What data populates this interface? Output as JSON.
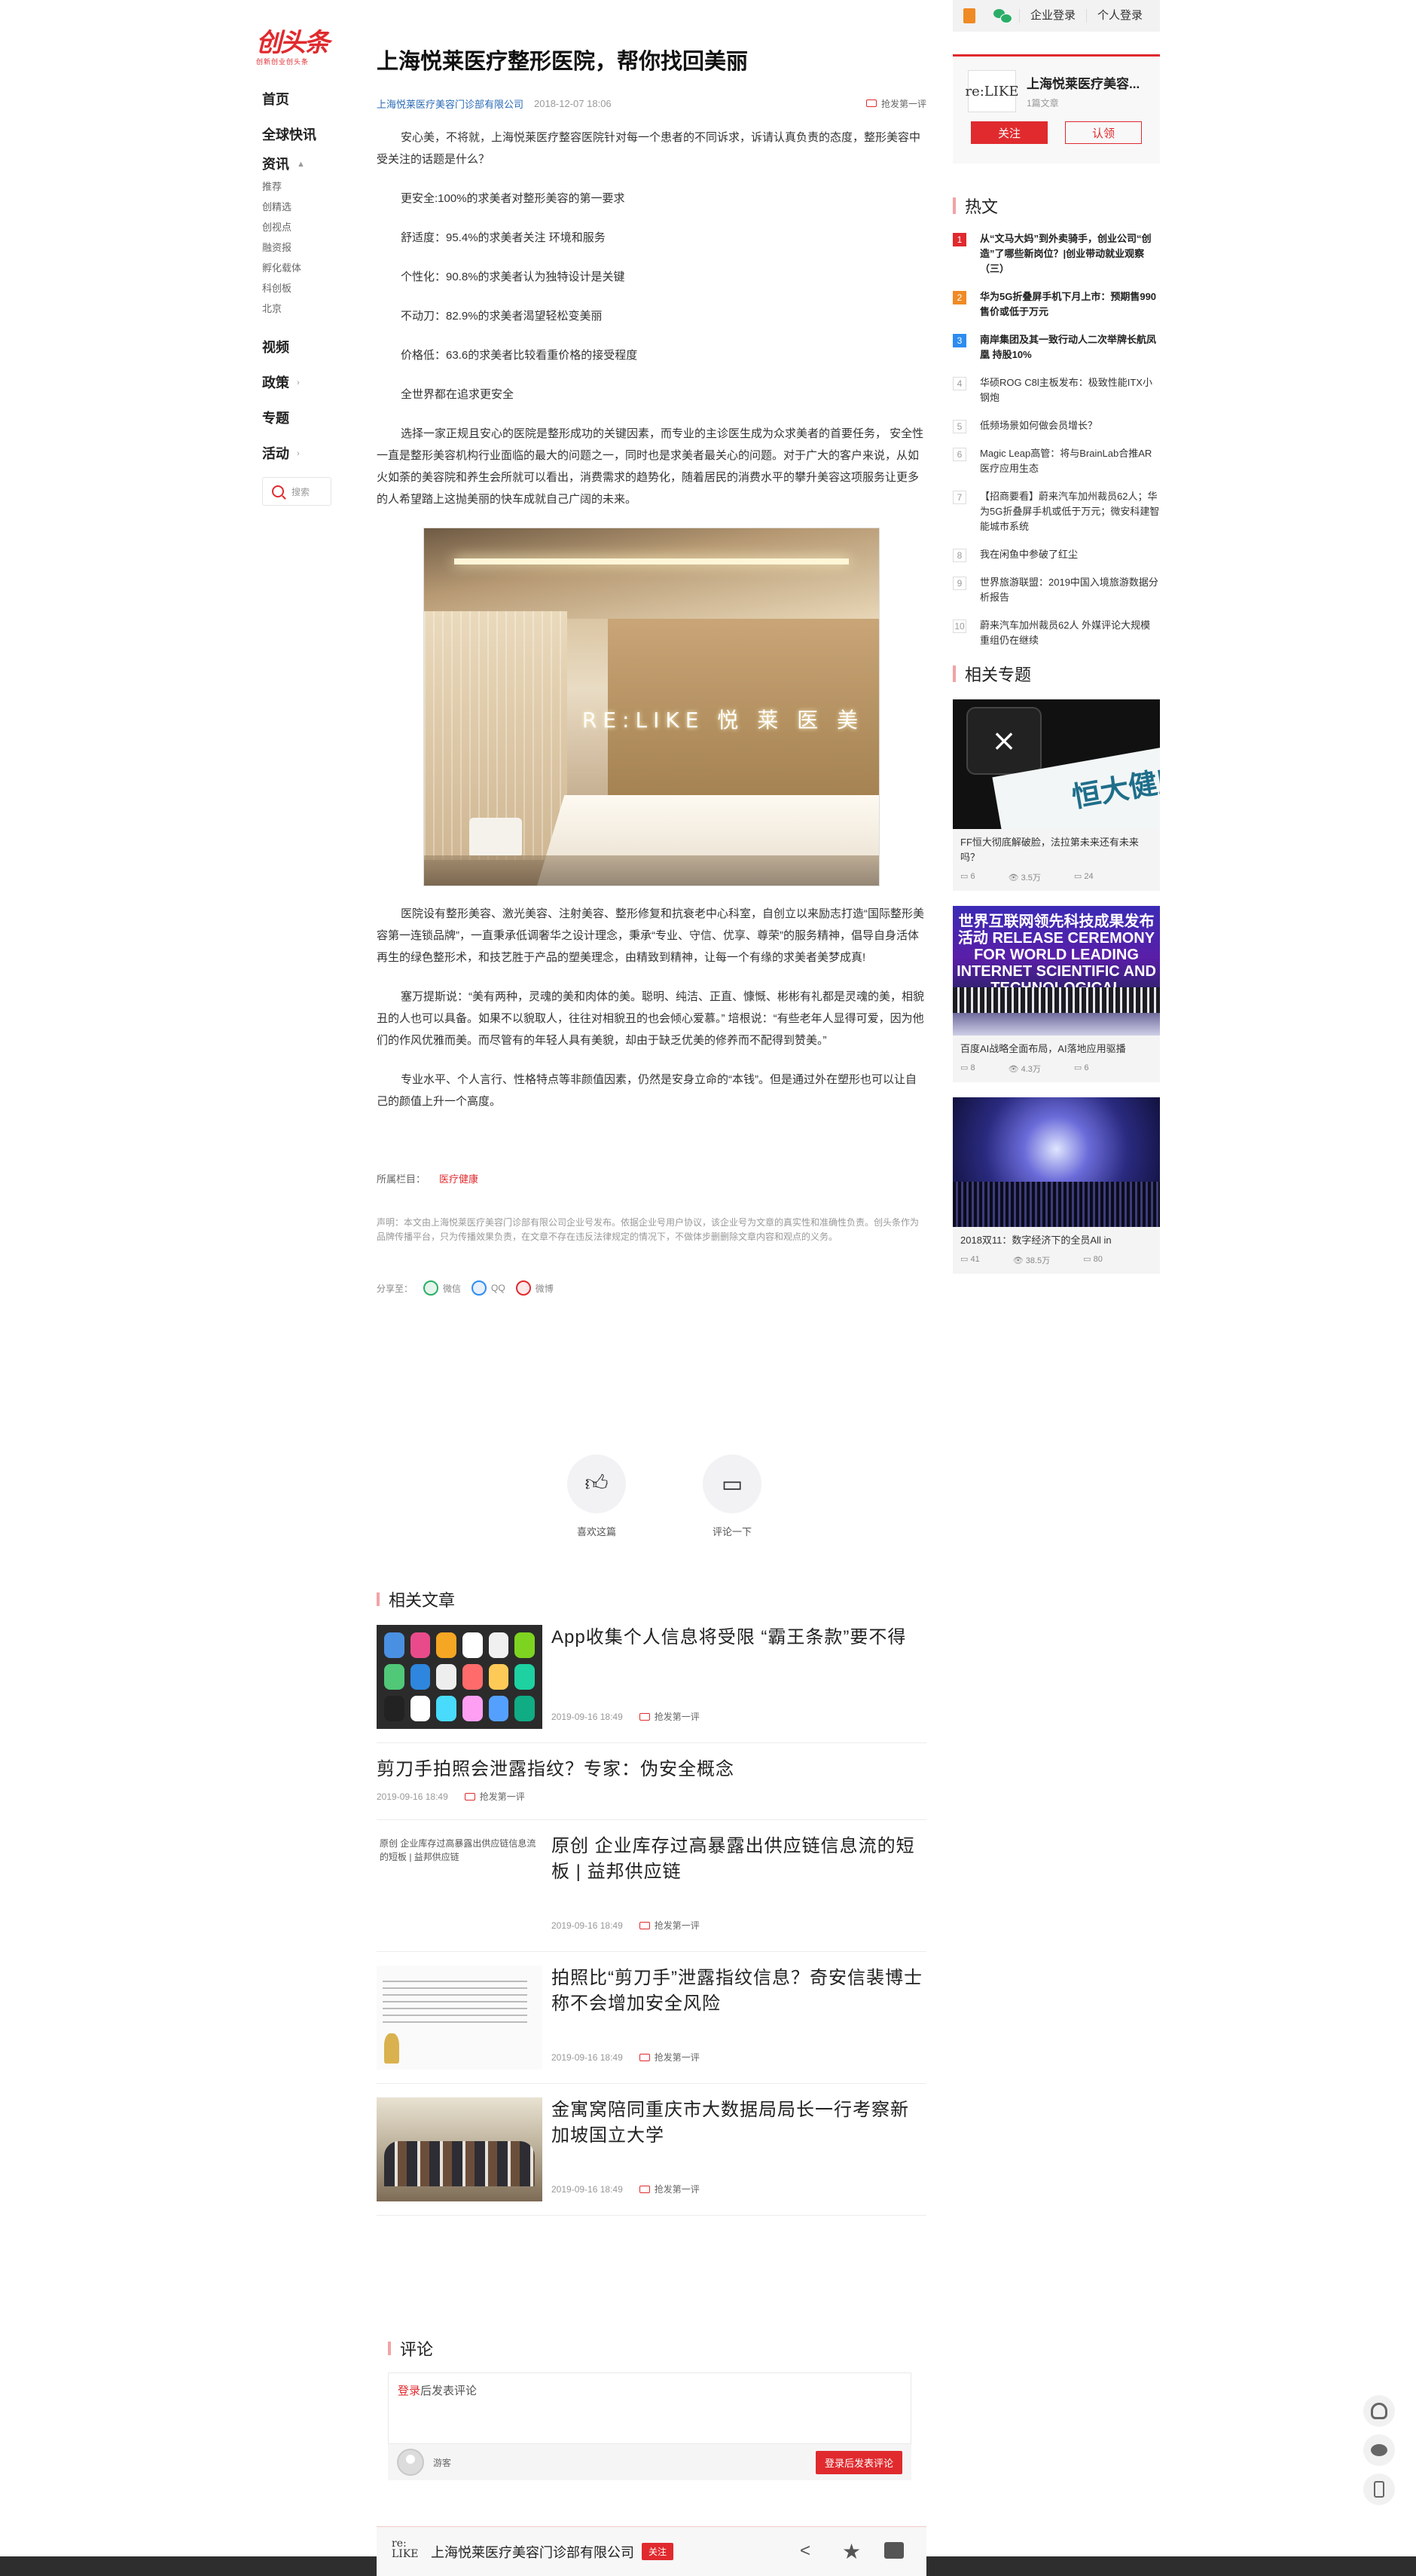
{
  "topbar": {
    "login_enterprise": "企业登录",
    "login_personal": "个人登录"
  },
  "logo": {
    "main": "创头条",
    "sub": "创新创业创头条"
  },
  "nav": {
    "home": "首页",
    "flash": "全球快讯",
    "news": "资讯",
    "news_subs": [
      "推荐",
      "创精选",
      "创视点",
      "融资报",
      "孵化载体",
      "科创板",
      "北京"
    ],
    "video": "视频",
    "policy": "政策",
    "topic": "专题",
    "event": "活动",
    "search": "搜索"
  },
  "article": {
    "title": "上海悦莱医疗整形医院，帮你找回美丽",
    "author": "上海悦莱医疗美容门诊部有限公司",
    "date": "2018-12-07 18:06",
    "first_comment": "抢发第一评",
    "p1": "安心美，不将就，上海悦莱医疗整容医院针对每一个患者的不同诉求，诉请认真负责的态度，整形美容中受关注的话题是什么？",
    "items": [
      "更安全:100%的求美者对整形美容的第一要求",
      "舒适度：95.4%的求美者关注 环境和服务",
      "个性化：90.8%的求美者认为独特设计是关键",
      "不动刀：82.9%的求美者渴望轻松变美丽",
      "价格低：63.6的求美者比较看重价格的接受程度",
      "全世界都在追求更安全"
    ],
    "p2": "选择一家正规且安心的医院是整形成功的关键因素，而专业的主诊医生成为众求美者的首要任务，  安全性一直是整形美容机构行业面临的最大的问题之一，同时也是求美者最关心的问题。对于广大的客户来说，从如火如荼的美容院和养生会所就可以看出，消费需求的趋势化，随着居民的消费水平的攀升美容这项服务让更多的人希望踏上这抛美丽的快车成就自己广阔的未来。",
    "image_sign": "RE:LIKE 悦 莱 医 美",
    "p3": "医院设有整形美容、激光美容、注射美容、整形修复和抗衰老中心科室，自创立以来励志打造“国际整形美容第一连锁品牌”，一直秉承低调奢华之设计理念，秉承“专业、守信、优享、尊荣”的服务精神，倡导自身活体再生的绿色整形术，和技艺胜于产品的塑美理念，由精致到精神，让每一个有缘的求美者美梦成真!",
    "p4": "塞万提斯说：“美有两种，灵魂的美和肉体的美。聪明、纯洁、正直、慷慨、彬彬有礼都是灵魂的美，相貌丑的人也可以具备。如果不以貌取人，往往对相貌丑的也会倾心爱慕。”   培根说：“有些老年人显得可爱，因为他们的作风优雅而美。而尽管有的年轻人具有美貌，却由于缺乏优美的修养而不配得到赞美。”",
    "p5": "专业水平、个人言行、性格特点等非颜值因素，仍然是安身立命的“本钱”。但是通过外在塑形也可以让自己的颜值上升一个高度。",
    "column_label": "所属栏目：",
    "column_tag": "医疗健康",
    "disclaimer": "声明：本文由上海悦莱医疗美容门诊部有限公司企业号发布。依据企业号用户协议，该企业号为文章的真实性和准确性负责。创头条作为品牌传播平台，只为传播效果负责，在文章不存在违反法律规定的情况下，不做体步删删除文章内容和观点的义务。",
    "share_label": "分享至：",
    "share": [
      "微信",
      "QQ",
      "微博"
    ],
    "like_label": "喜欢这篇",
    "comment_label": "评论一下"
  },
  "related": {
    "title": "相关文章",
    "items": [
      {
        "title": "App收集个人信息将受限 “霸王条款”要不得",
        "date": "2019-09-16 18:49",
        "fc": "抢发第一评"
      },
      {
        "title": "剪刀手拍照会泄露指纹？专家：伪安全概念",
        "date": "2019-09-16 18:49",
        "fc": "抢发第一评"
      },
      {
        "title": "原创 企业库存过高暴露出供应链信息流的短板 | 益邦供应链",
        "date": "2019-09-16 18:49",
        "fc": "抢发第一评",
        "img_alt": "原创 企业库存过高暴露出供应链信息流的短板 | 益邦供应链"
      },
      {
        "title": "拍照比“剪刀手”泄露指纹信息？奇安信裴博士称不会增加安全风险",
        "date": "2019-09-16 18:49",
        "fc": "抢发第一评"
      },
      {
        "title": "金寓窝陪同重庆市大数据局局长一行考察新加坡国立大学",
        "date": "2019-09-16 18:49",
        "fc": "抢发第一评"
      }
    ]
  },
  "comments": {
    "title": "评论",
    "login_link": "登录",
    "login_suffix": "后发表评论",
    "guest": "游客",
    "submit": "登录后发表评论"
  },
  "bottombar": {
    "name": "上海悦莱医疗美容门诊部有限公司",
    "follow": "关注"
  },
  "sidebar": {
    "card": {
      "name": "上海悦莱医疗美容...",
      "count": "1篇文章",
      "follow": "关注",
      "claim": "认领"
    },
    "hot_title": "热文",
    "hot": [
      "从“文马大妈”到外卖骑手，创业公司“创造”了哪些新岗位？|创业带动就业观察（三）",
      "华为5G折叠屏手机下月上市：预期售990 售价或低于万元",
      "南岸集团及其一致行动人二次举牌长航凤凰 持股10%",
      "华硕ROG C8l主板发布：极致性能ITX小钢炮",
      "低频场景如何做会员增长？",
      "Magic Leap高管：将与BrainLab合推AR医疗应用生态",
      "【招商要看】蔚来汽车加州裁员62人；华为5G折叠屏手机或低于万元；微安科建智能城市系统",
      "我在闲鱼中参破了红尘",
      "世界旅游联盟：2019中国入境旅游数据分析报告",
      "蔚来汽车加州裁员62人 外媒评论大规模重组仍在继续"
    ],
    "topics_title": "相关专题",
    "topics": [
      {
        "title": "FF恒大彻底解破脸，法拉第未来还有未来吗？",
        "comments": "6",
        "views": "3.5万",
        "likes": "24",
        "img_text": "恒大健康"
      },
      {
        "title": "百度AI战略全面布局，AI落地应用驱播",
        "comments": "8",
        "views": "4.3万",
        "likes": "6",
        "img_text": "世界互联网领先科技成果发布活动 RELEASE CEREMONY FOR WORLD LEADING INTERNET SCIENTIFIC AND TECHNOLOGICAL ACHIEVEMENTS"
      },
      {
        "title": "2018双11：数字经济下的全员All in",
        "comments": "41",
        "views": "38.5万",
        "likes": "80"
      }
    ]
  }
}
